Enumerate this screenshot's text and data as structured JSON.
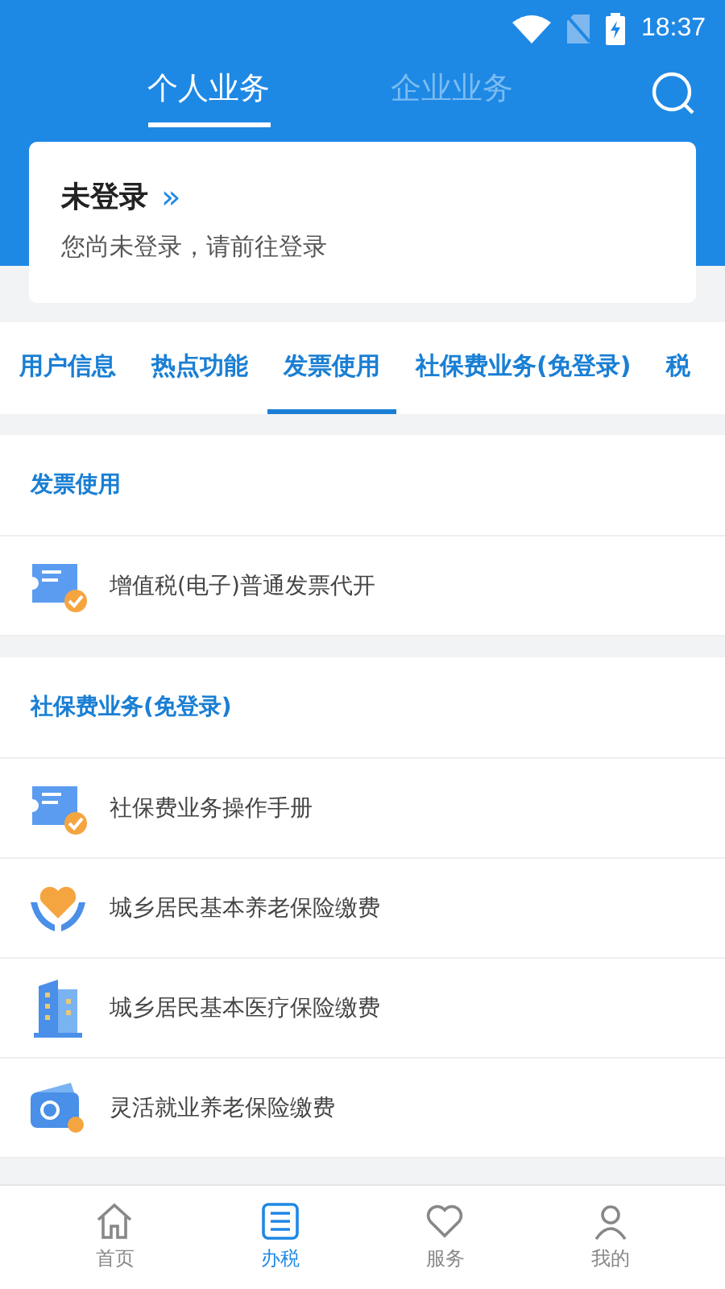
{
  "status_bar": {
    "time": "18:37"
  },
  "top_tabs": [
    {
      "label": "个人业务",
      "selected": true
    },
    {
      "label": "企业业务",
      "selected": false
    }
  ],
  "login_card": {
    "title": "未登录",
    "arrow": "»",
    "subtitle": "您尚未登录，请前往登录"
  },
  "category_tabs": [
    {
      "label": "用户信息",
      "selected": false
    },
    {
      "label": "热点功能",
      "selected": false
    },
    {
      "label": "发票使用",
      "selected": true
    },
    {
      "label": "社保费业务(免登录)",
      "selected": false
    },
    {
      "label": "税",
      "selected": false
    }
  ],
  "sections": [
    {
      "title": "发票使用",
      "items": [
        {
          "label": "增值税(电子)普通发票代开",
          "kind": "ticket"
        }
      ]
    },
    {
      "title": "社保费业务(免登录)",
      "items": [
        {
          "label": "社保费业务操作手册",
          "kind": "ticket"
        },
        {
          "label": "城乡居民基本养老保险缴费",
          "kind": "heart"
        },
        {
          "label": "城乡居民基本医疗保险缴费",
          "kind": "building"
        },
        {
          "label": "灵活就业养老保险缴费",
          "kind": "wallet"
        }
      ]
    }
  ],
  "bottom_nav": [
    {
      "label": "首页",
      "kind": "home",
      "selected": false
    },
    {
      "label": "办税",
      "kind": "list",
      "selected": true
    },
    {
      "label": "服务",
      "kind": "heart",
      "selected": false
    },
    {
      "label": "我的",
      "kind": "person",
      "selected": false
    }
  ]
}
